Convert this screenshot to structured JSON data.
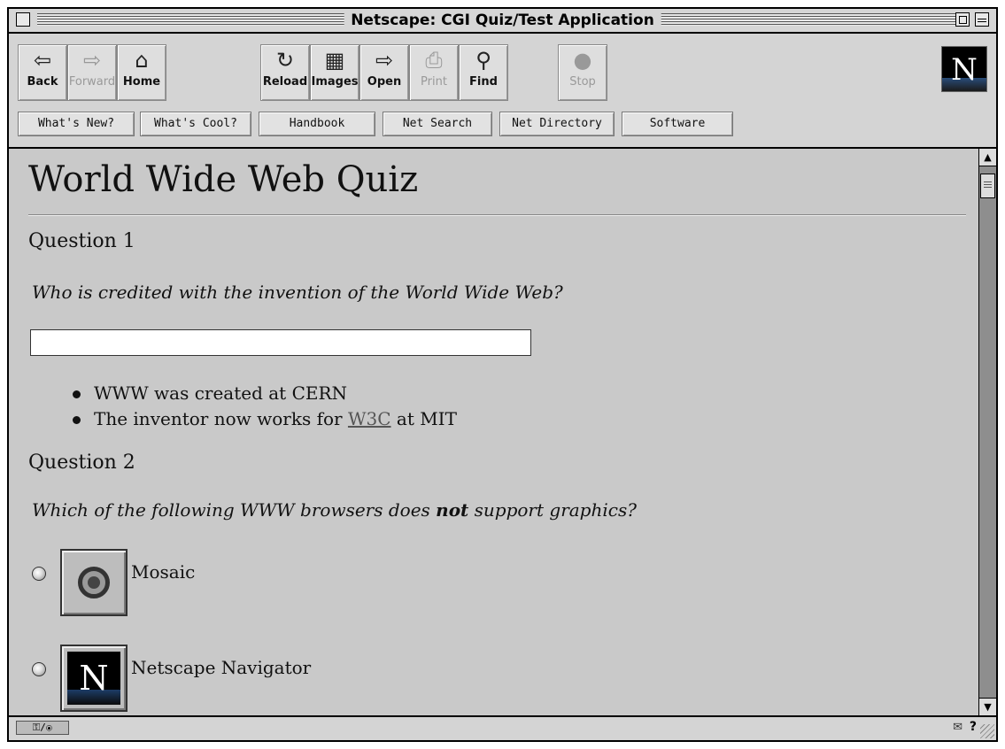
{
  "window": {
    "title": "Netscape: CGI Quiz/Test Application"
  },
  "toolbar": {
    "buttons": [
      {
        "label": "Back",
        "icon": "⇦"
      },
      {
        "label": "Forward",
        "icon": "⇨"
      },
      {
        "label": "Home",
        "icon": "⌂"
      },
      {
        "label": "Reload",
        "icon": "↻"
      },
      {
        "label": "Images",
        "icon": "▦"
      },
      {
        "label": "Open",
        "icon": "⇨"
      },
      {
        "label": "Print",
        "icon": "⎙"
      },
      {
        "label": "Find",
        "icon": "⚲"
      },
      {
        "label": "Stop",
        "icon": "●"
      }
    ],
    "directory": [
      "What's New?",
      "What's Cool?",
      "Handbook",
      "Net Search",
      "Net Directory",
      "Software"
    ],
    "logo_letter": "N"
  },
  "page": {
    "title": "World Wide Web Quiz",
    "q1": {
      "heading": "Question 1",
      "prompt": "Who is credited with the invention of the World Wide Web?",
      "answer_value": "",
      "hints": [
        "WWW was created at CERN",
        "The inventor now works for ",
        "W3C",
        " at MIT"
      ]
    },
    "q2": {
      "heading": "Question 2",
      "prompt_before": "Which of the following WWW browsers does ",
      "prompt_emph": "not",
      "prompt_after": " support graphics?",
      "options": [
        "Mosaic",
        "Netscape Navigator"
      ],
      "netscape_letter": "N"
    }
  },
  "status": {
    "security_icon": "⚿/⦿",
    "help": "?"
  }
}
